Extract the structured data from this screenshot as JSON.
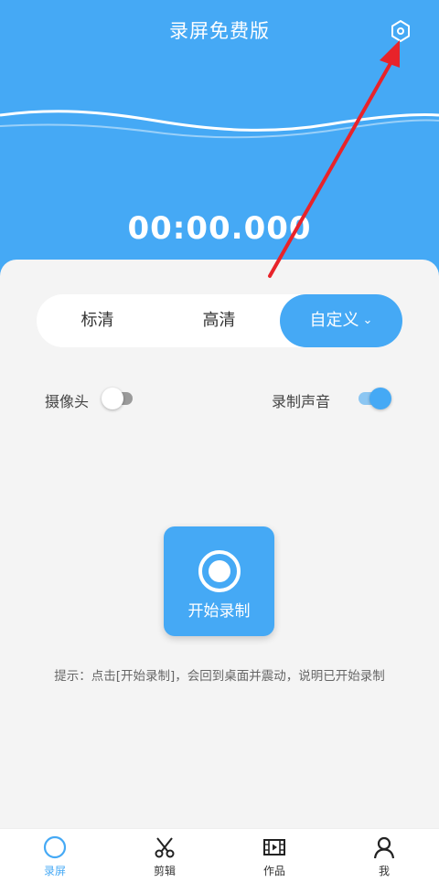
{
  "header": {
    "title": "录屏免费版",
    "settings_icon": "hexagon-settings-icon",
    "timer": "00:00.000"
  },
  "quality": {
    "options": [
      "标清",
      "高清",
      "自定义"
    ],
    "selected": "自定义",
    "dropdown_icon": "chevron-down-icon"
  },
  "toggles": {
    "camera": {
      "label": "摄像头",
      "on": false
    },
    "audio": {
      "label": "录制声音",
      "on": true
    }
  },
  "record": {
    "label": "开始录制",
    "icon": "record-circle-icon"
  },
  "hint": "提示：点击[开始录制]，会回到桌面并震动，说明已开始录制",
  "nav": {
    "items": [
      {
        "label": "录屏",
        "icon": "record-circle-icon",
        "active": true
      },
      {
        "label": "剪辑",
        "icon": "scissors-icon",
        "active": false
      },
      {
        "label": "作品",
        "icon": "film-icon",
        "active": false
      },
      {
        "label": "我",
        "icon": "user-icon",
        "active": false
      }
    ]
  },
  "colors": {
    "primary": "#45a9f5",
    "background": "#f4f4f4",
    "annotation_arrow": "#e8232a"
  }
}
